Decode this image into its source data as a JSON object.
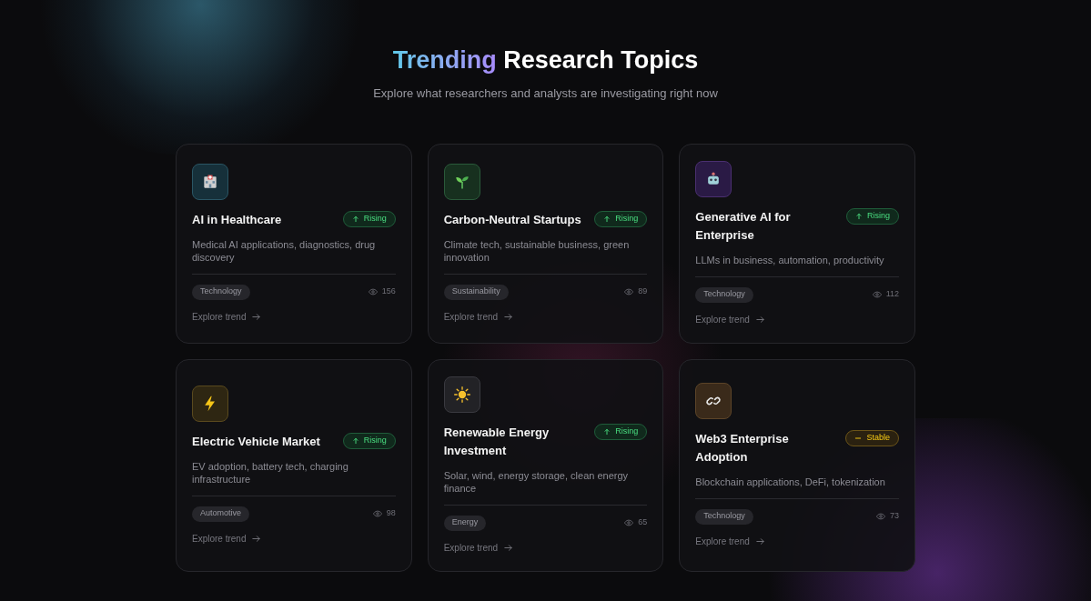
{
  "header": {
    "title_highlight": "Trending",
    "title_rest": "Research Topics",
    "subtitle": "Explore what researchers and analysts are investigating right now"
  },
  "topics": [
    {
      "kind": "hospital",
      "title": "AI in Healthcare",
      "badge": {
        "kind": "rising",
        "label": "Rising"
      },
      "description": "Medical AI applications, diagnostics, drug discovery",
      "category": "Technology",
      "views": "156",
      "link": "Explore trend"
    },
    {
      "kind": "seedling",
      "title": "Carbon-Neutral Startups",
      "badge": {
        "kind": "rising",
        "label": "Rising"
      },
      "description": "Climate tech, sustainable business, green innovation",
      "category": "Sustainability",
      "views": "89",
      "link": "Explore trend"
    },
    {
      "kind": "robot",
      "title": "Generative AI for Enterprise",
      "badge": {
        "kind": "rising",
        "label": "Rising"
      },
      "description": "LLMs in business, automation, productivity",
      "category": "Technology",
      "views": "112",
      "link": "Explore trend"
    },
    {
      "kind": "lightning",
      "title": "Electric Vehicle Market",
      "badge": {
        "kind": "rising",
        "label": "Rising"
      },
      "description": "EV adoption, battery tech, charging infrastructure",
      "category": "Automotive",
      "views": "98",
      "link": "Explore trend"
    },
    {
      "kind": "sun",
      "title": "Renewable Energy Investment",
      "badge": {
        "kind": "rising",
        "label": "Rising"
      },
      "description": "Solar, wind, energy storage, clean energy finance",
      "category": "Energy",
      "views": "65",
      "link": "Explore trend"
    },
    {
      "kind": "link",
      "title": "Web3 Enterprise Adoption",
      "badge": {
        "kind": "stable",
        "label": "Stable"
      },
      "description": "Blockchain applications, DeFi, tokenization",
      "category": "Technology",
      "views": "73",
      "link": "Explore trend"
    }
  ]
}
